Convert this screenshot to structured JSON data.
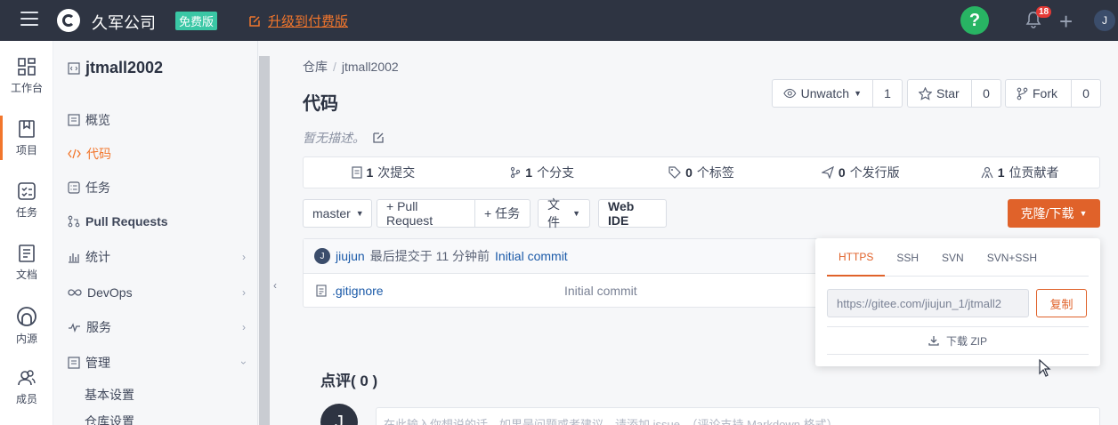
{
  "topbar": {
    "company": "久军公司",
    "free_badge": "免费版",
    "upgrade": "升级到付费版",
    "help": "?",
    "notification_count": "18",
    "plus": "+",
    "avatar": "J"
  },
  "rail": {
    "items": [
      {
        "label": "工作台",
        "icon": "dashboard-icon"
      },
      {
        "label": "项目",
        "icon": "book-icon"
      },
      {
        "label": "任务",
        "icon": "task-icon"
      },
      {
        "label": "文档",
        "icon": "doc-icon"
      },
      {
        "label": "内源",
        "icon": "innersource-icon"
      },
      {
        "label": "成员",
        "icon": "members-icon"
      }
    ]
  },
  "sidebar": {
    "project_name": "jtmall2002",
    "items": [
      {
        "label": "概览",
        "icon": "overview-icon"
      },
      {
        "label": "代码",
        "icon": "code-icon",
        "active": true
      },
      {
        "label": "任务",
        "icon": "task-icon"
      },
      {
        "label": "Pull Requests",
        "icon": "pull-request-icon"
      },
      {
        "label": "统计",
        "icon": "stats-icon"
      },
      {
        "label": "DevOps",
        "icon": "devops-icon"
      },
      {
        "label": "服务",
        "icon": "service-icon"
      },
      {
        "label": "管理",
        "icon": "manage-icon"
      }
    ],
    "sub_items": [
      "基本设置",
      "仓库设置"
    ]
  },
  "main": {
    "breadcrumb": [
      "仓库",
      "jtmall2002"
    ],
    "title": "代码",
    "description": "暂无描述。",
    "watch": {
      "label": "Unwatch",
      "count": "1"
    },
    "star": {
      "label": "Star",
      "count": "0"
    },
    "fork": {
      "label": "Fork",
      "count": "0"
    },
    "stats": [
      {
        "num": "1",
        "text": "次提交"
      },
      {
        "num": "1",
        "text": "个分支"
      },
      {
        "num": "0",
        "text": "个标签"
      },
      {
        "num": "0",
        "text": "个发行版"
      },
      {
        "num": "1",
        "text": "位贡献者"
      }
    ],
    "toolbar": {
      "branch": "master",
      "pull_request": "+ Pull Request",
      "task": "+ 任务",
      "file": "文件",
      "web_ide": "Web IDE",
      "clone": "克隆/下载"
    },
    "commit": {
      "avatar": "J",
      "author": "jiujun",
      "meta": "最后提交于 11 分钟前",
      "message": "Initial commit"
    },
    "files": [
      {
        "name": ".gitignore",
        "message": "Initial commit"
      }
    ],
    "comments": {
      "title": "点评( 0 )",
      "avatar": "J",
      "placeholder": "在此输入你想说的话，如果是问题或者建议，请添加 issue。（评论支持 Markdown 格式）"
    }
  },
  "clone_dropdown": {
    "tabs": [
      "HTTPS",
      "SSH",
      "SVN",
      "SVN+SSH"
    ],
    "active_tab": "HTTPS",
    "url": "https://gitee.com/jiujun_1/jtmall2",
    "copy": "复制",
    "download_zip": "下载 ZIP"
  },
  "colors": {
    "topbar": "#2e3442",
    "accent": "#e0622a",
    "help_green": "#28b463",
    "badge_green": "#3ac7a5"
  }
}
